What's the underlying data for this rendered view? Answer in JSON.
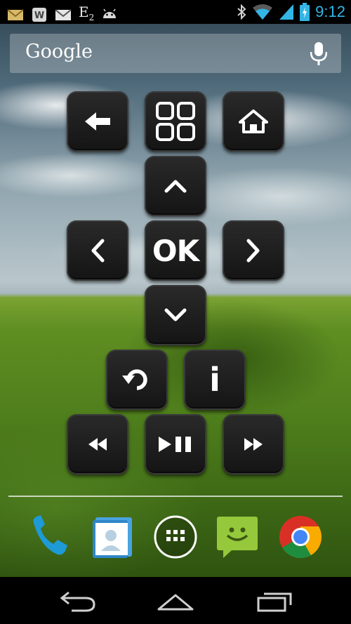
{
  "status_bar": {
    "left_icons": [
      "gmail-icon",
      "wordpress-icon",
      "email-icon",
      "e2-icon",
      "android-icon"
    ],
    "e2_text": "E",
    "e2_sub": "2",
    "right_icons": [
      "bluetooth-icon",
      "wifi-icon",
      "signal-icon",
      "battery-icon"
    ],
    "time": "9:12",
    "accent_color": "#33b5e5"
  },
  "search": {
    "brand": "Google",
    "icon": "mic-icon"
  },
  "remote": {
    "ok_label": "OK",
    "info_label": "i",
    "buttons": [
      "back",
      "apps",
      "home",
      "up",
      "left",
      "ok",
      "right",
      "down",
      "replay",
      "info",
      "rewind",
      "play-pause",
      "fast-forward"
    ]
  },
  "dock": {
    "items": [
      "phone",
      "contacts",
      "all-apps",
      "messaging",
      "chrome"
    ]
  },
  "nav_bar": {
    "items": [
      "back",
      "home",
      "recent-apps"
    ]
  }
}
